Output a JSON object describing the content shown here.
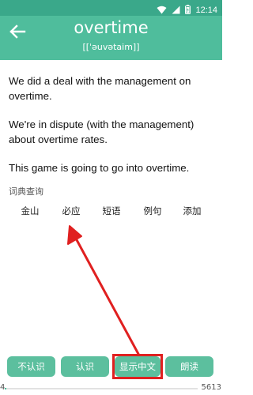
{
  "status_bar": {
    "time": "12:14",
    "icons": [
      "wifi-icon",
      "signal-icon",
      "battery-icon"
    ],
    "color": "#3aa88a"
  },
  "header": {
    "word": "overtime",
    "phonetic": "[[ˈəuvətaim]]",
    "color": "#4fbd9c"
  },
  "sentences": [
    "We did a deal with the management on overtime.",
    "We're in dispute (with the management) about overtime rates.",
    "This game is going to go into overtime."
  ],
  "dictionary": {
    "label": "词典查询",
    "links": [
      "金山",
      "必应",
      "短语",
      "例句",
      "添加"
    ]
  },
  "actions": {
    "unknown": "不认识",
    "known": "认识",
    "show_chinese": "显示中文",
    "read_aloud": "朗读"
  },
  "progress": {
    "current": "4",
    "total": "5613",
    "fraction": 0.0007
  },
  "annotation": {
    "arrow_color": "#e02020"
  }
}
